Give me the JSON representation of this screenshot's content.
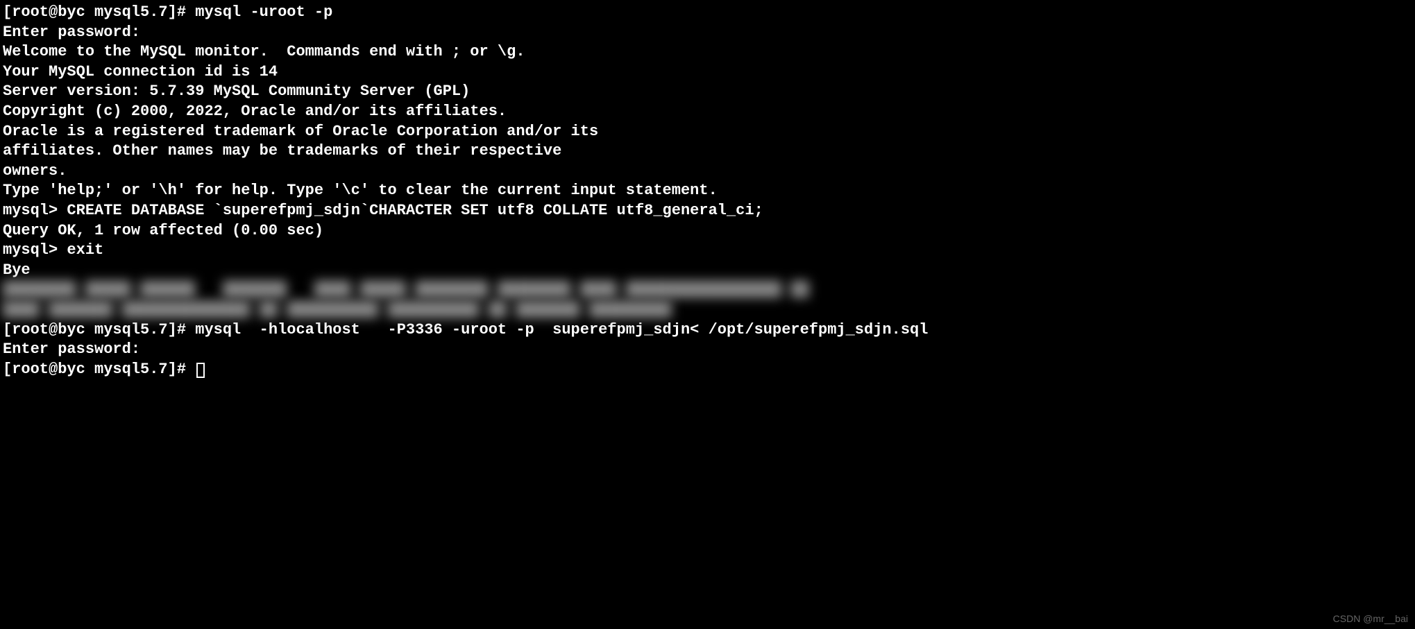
{
  "terminal": {
    "prompt1": "[root@byc mysql5.7]# ",
    "cmd1": "mysql -uroot -p",
    "line2": "Enter password:",
    "line3": "Welcome to the MySQL monitor.  Commands end with ; or \\g.",
    "line4": "Your MySQL connection id is 14",
    "line5": "Server version: 5.7.39 MySQL Community Server (GPL)",
    "line6": "",
    "line7": "Copyright (c) 2000, 2022, Oracle and/or its affiliates.",
    "line8": "",
    "line9": "Oracle is a registered trademark of Oracle Corporation and/or its",
    "line10": "affiliates. Other names may be trademarks of their respective",
    "line11": "owners.",
    "line12": "",
    "line13": "Type 'help;' or '\\h' for help. Type '\\c' to clear the current input statement.",
    "line14": "",
    "mysql_prompt": "mysql> ",
    "cmd2": "CREATE DATABASE `superefpmj_sdjn`CHARACTER SET utf8 COLLATE utf8_general_ci;",
    "line16": "Query OK, 1 row affected (0.00 sec)",
    "line17": "",
    "cmd3": "exit",
    "line19": "Bye",
    "blur1": "████████ █████ ██████   ███████   ████ █████ ████████ ████████ ████ █████████████████ ██",
    "blur2": "████ ███████ ██████████████ ██ ██████████ ██████████ ██ ███████ █████████",
    "prompt2": "[root@byc mysql5.7]# ",
    "cmd4": "mysql  -hlocalhost   -P3336 -uroot -p  superefpmj_sdjn< /opt/superefpmj_sdjn.sql",
    "line23": "Enter password:",
    "prompt3": "[root@byc mysql5.7]# "
  },
  "watermark": "CSDN @mr__bai"
}
